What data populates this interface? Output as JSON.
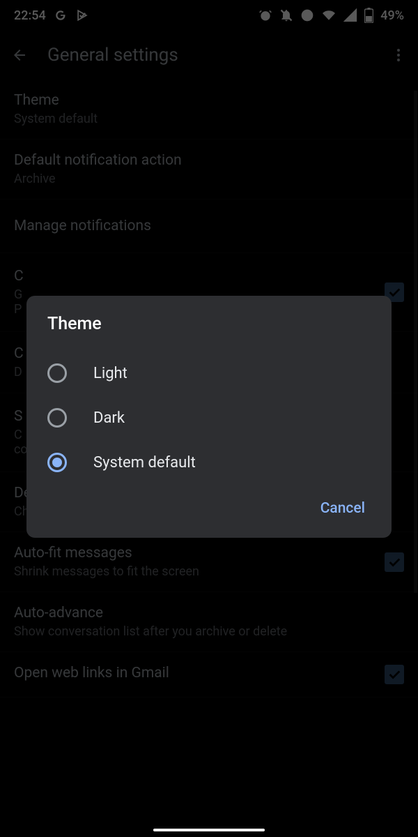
{
  "status": {
    "time": "22:54",
    "battery": "49%"
  },
  "header": {
    "title": "General settings"
  },
  "settings": [
    {
      "title": "Theme",
      "sub": "System default",
      "checkbox": false
    },
    {
      "title": "Default notification action",
      "sub": "Archive",
      "checkbox": false
    },
    {
      "title": "Manage notifications",
      "sub": "",
      "checkbox": false
    },
    {
      "title": "C",
      "sub": "G\nP",
      "checkbox": true
    },
    {
      "title": "C",
      "sub": "D",
      "checkbox": false
    },
    {
      "title": "S",
      "sub": "C\nco",
      "checkbox": false
    },
    {
      "title": "Default reply action",
      "sub": "Choose your default reply action",
      "checkbox": false
    },
    {
      "title": "Auto-fit messages",
      "sub": "Shrink messages to fit the screen",
      "checkbox": true
    },
    {
      "title": "Auto-advance",
      "sub": "Show conversation list after you archive or delete",
      "checkbox": false
    },
    {
      "title": "Open web links in Gmail",
      "sub": "",
      "checkbox": true
    }
  ],
  "dialog": {
    "title": "Theme",
    "options": [
      {
        "label": "Light",
        "selected": false
      },
      {
        "label": "Dark",
        "selected": false
      },
      {
        "label": "System default",
        "selected": true
      }
    ],
    "cancel": "Cancel"
  }
}
